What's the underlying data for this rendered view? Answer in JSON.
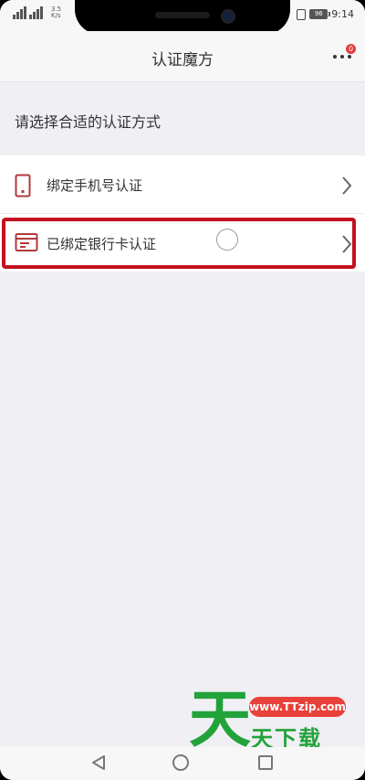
{
  "status_bar": {
    "network_speed": "3.5 K/s",
    "battery_level": "96",
    "time": "9:14"
  },
  "nav": {
    "title": "认证魔方",
    "more_badge": "0"
  },
  "section_title": "请选择合适的认证方式",
  "options": [
    {
      "label": "绑定手机号认证",
      "icon": "phone-icon"
    },
    {
      "label": "已绑定银行卡认证",
      "icon": "bank-card-icon"
    }
  ],
  "watermark": {
    "logo_char": "天",
    "url": "www.TTzip.com",
    "site_name": "天下载"
  },
  "colors": {
    "accent_red": "#c2121f",
    "icon_red": "#b23a3a",
    "watermark_green": "#22a33a"
  }
}
